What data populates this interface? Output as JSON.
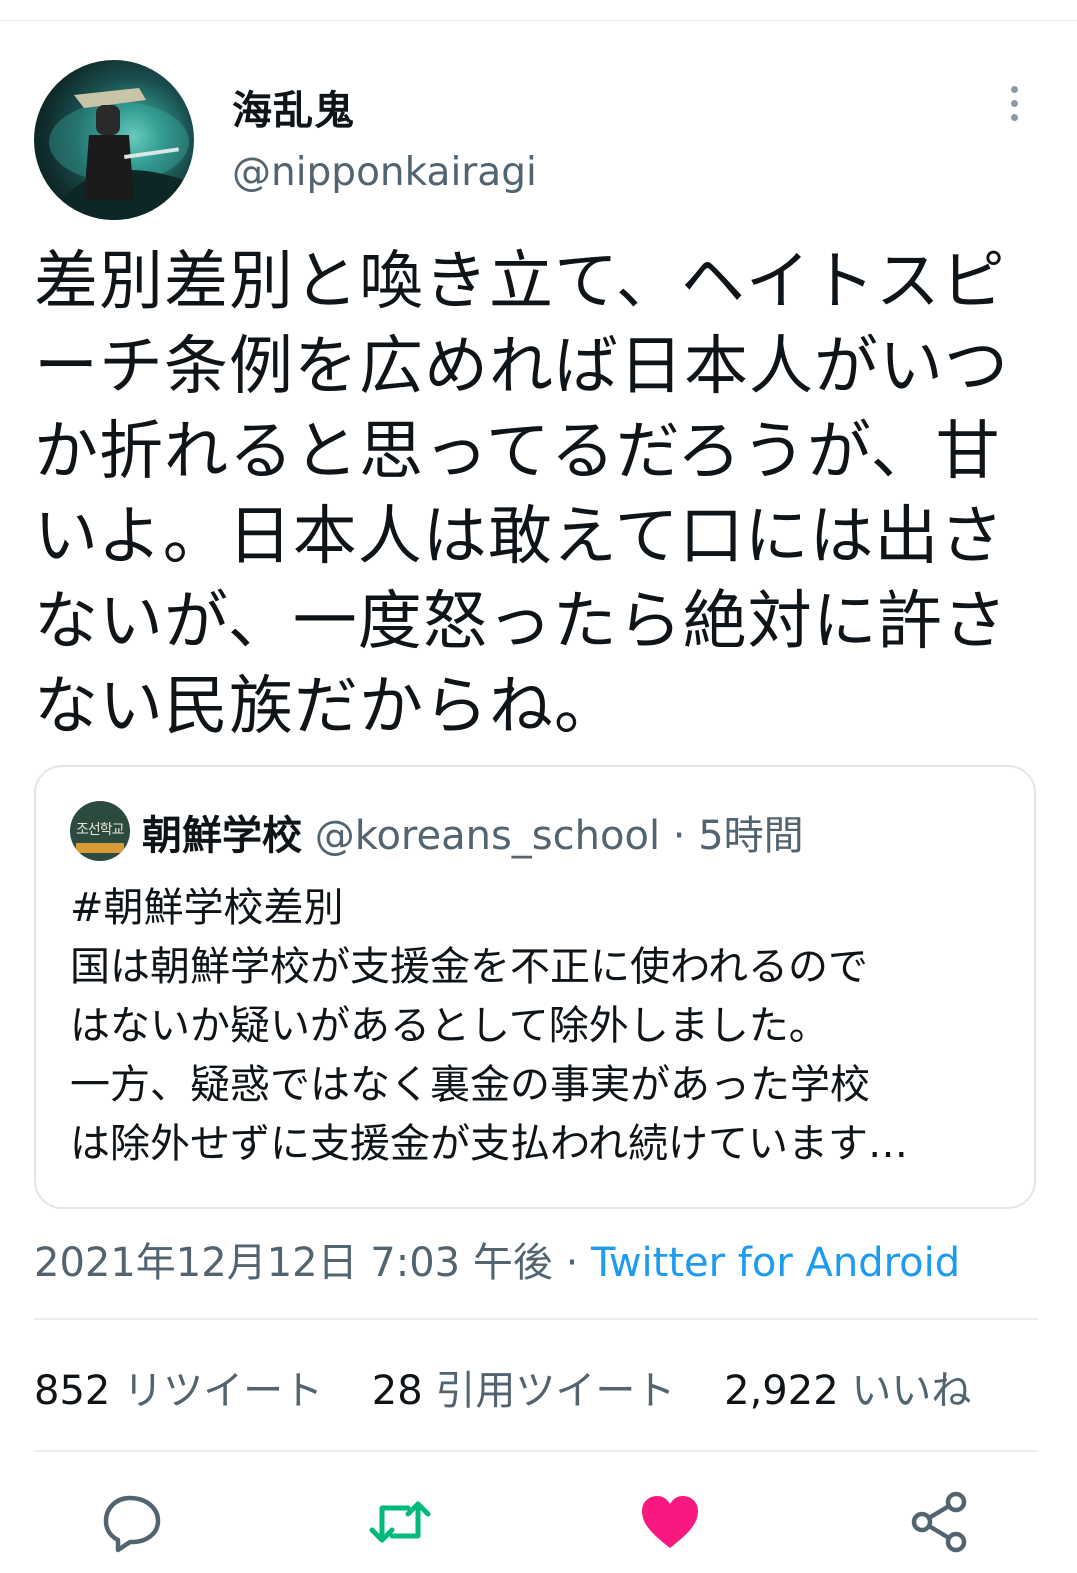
{
  "tweet": {
    "display_name": "海乱鬼",
    "handle": "@nipponkairagi",
    "text": "差別差別と喚き立て、ヘイトスピ\nーチ条例を広めれば日本人がいつ\nか折れると思ってるだろうが、甘\nいよ。日本人は敢えて口には出さ\nないが、一度怒ったら絶対に許さ\nない民族だからね。",
    "date": "2021年12月12日 7:03 午後",
    "separator": "·",
    "source": "Twitter for Android"
  },
  "quote": {
    "name": "朝鮮学校",
    "handle": "@koreans_school",
    "separator": "·",
    "time": "5時間",
    "avatar_text": "조선학교",
    "text": "#朝鮮学校差別\n国は朝鮮学校が支援金を不正に使われるので\nはないか疑いがあるとして除外しました。\n一方、疑惑ではなく裏金の事実があった学校\nは除外せずに支援金が支払われ続けています…"
  },
  "stats": {
    "retweets": {
      "count": "852",
      "label": "リツイート"
    },
    "quotes": {
      "count": "28",
      "label": "引用ツイート"
    },
    "likes": {
      "count": "2,922",
      "label": "いいね"
    }
  },
  "actions": {
    "reply": {
      "icon": "reply-icon",
      "color": "#536471"
    },
    "retweet": {
      "icon": "retweet-icon",
      "color": "#00ba7c"
    },
    "like": {
      "icon": "heart-icon",
      "color": "#f91880"
    },
    "share": {
      "icon": "share-icon",
      "color": "#536471"
    }
  },
  "colors": {
    "text": "#0f1419",
    "secondary": "#536471",
    "link": "#1d9bf0",
    "retweet_active": "#00ba7c",
    "like_active": "#f91880",
    "border": "#e2e6ea"
  }
}
